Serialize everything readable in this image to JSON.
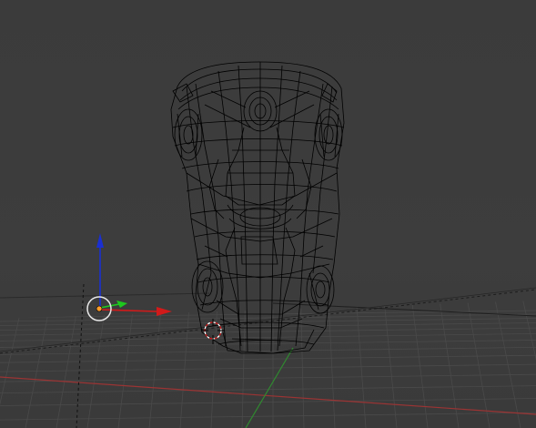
{
  "viewport": {
    "background_color": "#3d3d3d",
    "grid_color": "#4a4a4a",
    "x_axis_color": "#9b3434",
    "y_axis_color": "#2f8b2f",
    "wireframe_color": "#000000",
    "selected_object": "car-wireframe-model",
    "view_mode": "wireframe"
  },
  "gizmo": {
    "name": "translate-manipulator",
    "x_arrow_color": "#d21a1a",
    "y_arrow_color": "#1ec81e",
    "z_arrow_color": "#1a2fd2",
    "origin_color": "#ff9d2a"
  },
  "cursor_3d": {
    "name": "3d-cursor",
    "ring_colors": [
      "#ffffff",
      "#d21a1a"
    ]
  }
}
